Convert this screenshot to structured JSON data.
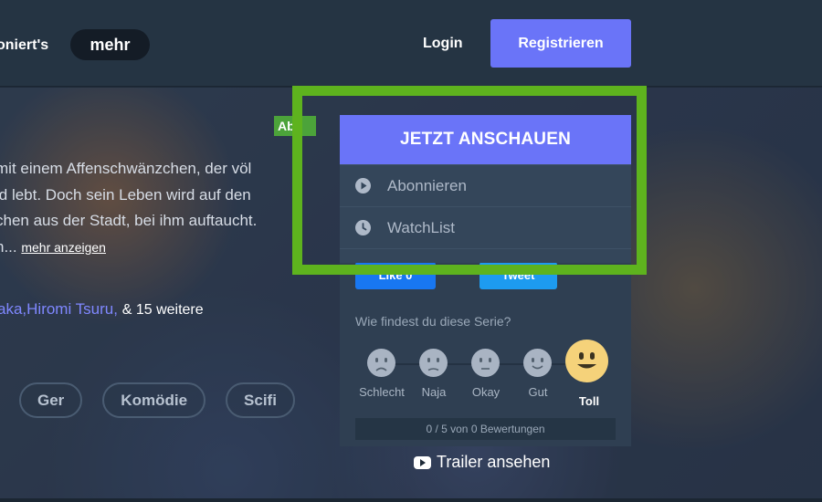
{
  "nav": {
    "partial_item": "oniert's",
    "more_label": "mehr",
    "login_label": "Login",
    "register_label": "Registrieren"
  },
  "hero": {
    "badge": "Abo",
    "synopsis_lines": [
      " mit einem Affenschwänzchen, der völ",
      "ld lebt. Doch sein Leben wird auf den",
      "chen aus der Stadt, bei ihm auftaucht.",
      "n..."
    ],
    "more_link": "mehr anzeigen",
    "cast": {
      "names": [
        "aka,",
        "Hiromi Tsuru,"
      ],
      "more": "& 15 weitere"
    },
    "tags": [
      "Ger",
      "Komödie",
      "Scifi"
    ]
  },
  "panel": {
    "watch_now": "JETZT ANSCHAUEN",
    "menu": [
      {
        "label": "Abonnieren",
        "icon": "play-circle-icon"
      },
      {
        "label": "WatchList",
        "icon": "clock-icon"
      }
    ],
    "social": {
      "facebook": "Like 0",
      "twitter": "Tweet"
    },
    "rating": {
      "question": "Wie findest du diese Serie?",
      "options": [
        "Schlecht",
        "Naja",
        "Okay",
        "Gut",
        "Toll"
      ],
      "selected": "Toll",
      "count_text": "0 / 5 von 0 Bewertungen"
    },
    "trailer_label": "Trailer ansehen"
  },
  "colors": {
    "accent": "#6a74f8",
    "highlight_frame": "#5eb31e",
    "badge": "#4ca33a"
  }
}
